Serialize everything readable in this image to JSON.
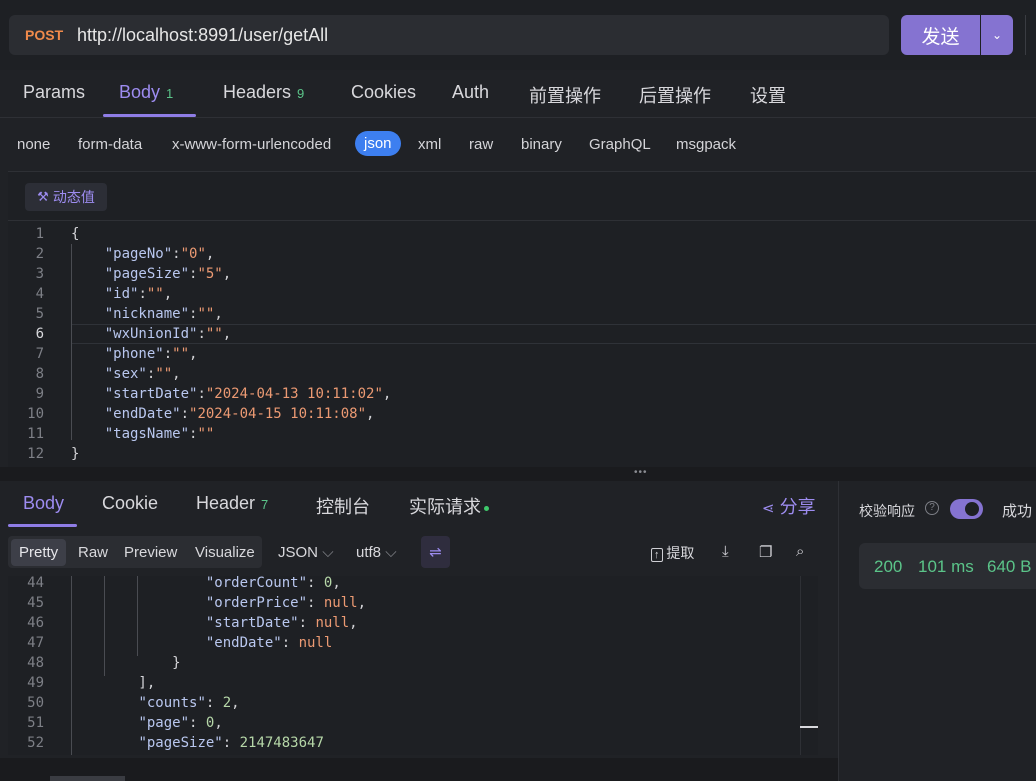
{
  "request": {
    "method": "POST",
    "url": "http://localhost:8991/user/getAll",
    "send_label": "发送",
    "send_dropdown_icon": "chevron-down-icon"
  },
  "req_tabs": [
    {
      "label": "Params",
      "badge": ""
    },
    {
      "label": "Body",
      "badge": "1"
    },
    {
      "label": "Headers",
      "badge": "9"
    },
    {
      "label": "Cookies",
      "badge": ""
    },
    {
      "label": "Auth",
      "badge": ""
    },
    {
      "label": "前置操作",
      "badge": ""
    },
    {
      "label": "后置操作",
      "badge": ""
    },
    {
      "label": "设置",
      "badge": ""
    }
  ],
  "body_types": [
    "none",
    "form-data",
    "x-www-form-urlencoded",
    "json",
    "xml",
    "raw",
    "binary",
    "GraphQL",
    "msgpack"
  ],
  "body_type_selected": "json",
  "dynamic_value_label": "动态值",
  "request_body_lines": [
    {
      "n": "1",
      "parts": [
        [
          "p",
          "{"
        ]
      ]
    },
    {
      "n": "2",
      "parts": [
        [
          "p",
          "    "
        ],
        [
          "k",
          "\"pageNo\""
        ],
        [
          "p",
          ":"
        ],
        [
          "s",
          "\"0\""
        ],
        [
          "p",
          ","
        ]
      ]
    },
    {
      "n": "3",
      "parts": [
        [
          "p",
          "    "
        ],
        [
          "k",
          "\"pageSize\""
        ],
        [
          "p",
          ":"
        ],
        [
          "s",
          "\"5\""
        ],
        [
          "p",
          ","
        ]
      ]
    },
    {
      "n": "4",
      "parts": [
        [
          "p",
          "    "
        ],
        [
          "k",
          "\"id\""
        ],
        [
          "p",
          ":"
        ],
        [
          "s",
          "\"\""
        ],
        [
          "p",
          ","
        ]
      ]
    },
    {
      "n": "5",
      "parts": [
        [
          "p",
          "    "
        ],
        [
          "k",
          "\"nickname\""
        ],
        [
          "p",
          ":"
        ],
        [
          "s",
          "\"\""
        ],
        [
          "p",
          ","
        ]
      ]
    },
    {
      "n": "6",
      "parts": [
        [
          "p",
          "    "
        ],
        [
          "k",
          "\"wxUnionId\""
        ],
        [
          "p",
          ":"
        ],
        [
          "s",
          "\"\""
        ],
        [
          "p",
          ","
        ]
      ]
    },
    {
      "n": "7",
      "parts": [
        [
          "p",
          "    "
        ],
        [
          "k",
          "\"phone\""
        ],
        [
          "p",
          ":"
        ],
        [
          "s",
          "\"\""
        ],
        [
          "p",
          ","
        ]
      ]
    },
    {
      "n": "8",
      "parts": [
        [
          "p",
          "    "
        ],
        [
          "k",
          "\"sex\""
        ],
        [
          "p",
          ":"
        ],
        [
          "s",
          "\"\""
        ],
        [
          "p",
          ","
        ]
      ]
    },
    {
      "n": "9",
      "parts": [
        [
          "p",
          "    "
        ],
        [
          "k",
          "\"startDate\""
        ],
        [
          "p",
          ":"
        ],
        [
          "s",
          "\"2024-04-13 10:11:02\""
        ],
        [
          "p",
          ","
        ]
      ]
    },
    {
      "n": "10",
      "parts": [
        [
          "p",
          "    "
        ],
        [
          "k",
          "\"endDate\""
        ],
        [
          "p",
          ":"
        ],
        [
          "s",
          "\"2024-04-15 10:11:08\""
        ],
        [
          "p",
          ","
        ]
      ]
    },
    {
      "n": "11",
      "parts": [
        [
          "p",
          "    "
        ],
        [
          "k",
          "\"tagsName\""
        ],
        [
          "p",
          ":"
        ],
        [
          "s",
          "\"\""
        ]
      ]
    },
    {
      "n": "12",
      "parts": [
        [
          "p",
          "}"
        ]
      ]
    }
  ],
  "current_line": "6",
  "resp_tabs": [
    {
      "label": "Body",
      "badge": ""
    },
    {
      "label": "Cookie",
      "badge": ""
    },
    {
      "label": "Header",
      "badge": "7"
    },
    {
      "label": "控制台",
      "badge": ""
    },
    {
      "label": "实际请求",
      "badge": ""
    }
  ],
  "share_label": "分享",
  "format_tabs": [
    "Pretty",
    "Raw",
    "Preview",
    "Visualize"
  ],
  "format_selected": "Pretty",
  "lang_select": "JSON",
  "encoding_select": "utf8",
  "extract_label": "提取",
  "response_lines": [
    {
      "n": "44",
      "parts": [
        [
          "p",
          "                "
        ],
        [
          "k",
          "\"orderCount\""
        ],
        [
          "p",
          ": "
        ],
        [
          "n",
          "0"
        ],
        [
          "p",
          ","
        ]
      ]
    },
    {
      "n": "45",
      "parts": [
        [
          "p",
          "                "
        ],
        [
          "k",
          "\"orderPrice\""
        ],
        [
          "p",
          ": "
        ],
        [
          "nl",
          "null"
        ],
        [
          "p",
          ","
        ]
      ]
    },
    {
      "n": "46",
      "parts": [
        [
          "p",
          "                "
        ],
        [
          "k",
          "\"startDate\""
        ],
        [
          "p",
          ": "
        ],
        [
          "nl",
          "null"
        ],
        [
          "p",
          ","
        ]
      ]
    },
    {
      "n": "47",
      "parts": [
        [
          "p",
          "                "
        ],
        [
          "k",
          "\"endDate\""
        ],
        [
          "p",
          ": "
        ],
        [
          "nl",
          "null"
        ]
      ]
    },
    {
      "n": "48",
      "parts": [
        [
          "p",
          "            }"
        ]
      ]
    },
    {
      "n": "49",
      "parts": [
        [
          "p",
          "        ],"
        ]
      ]
    },
    {
      "n": "50",
      "parts": [
        [
          "p",
          "        "
        ],
        [
          "k",
          "\"counts\""
        ],
        [
          "p",
          ": "
        ],
        [
          "n",
          "2"
        ],
        [
          "p",
          ","
        ]
      ]
    },
    {
      "n": "51",
      "parts": [
        [
          "p",
          "        "
        ],
        [
          "k",
          "\"page\""
        ],
        [
          "p",
          ": "
        ],
        [
          "n",
          "0"
        ],
        [
          "p",
          ","
        ]
      ]
    },
    {
      "n": "52",
      "parts": [
        [
          "p",
          "        "
        ],
        [
          "k",
          "\"pageSize\""
        ],
        [
          "p",
          ": "
        ],
        [
          "n",
          "2147483647"
        ]
      ]
    }
  ],
  "verify": {
    "label": "校验响应",
    "toggle_on": true,
    "result": "成功"
  },
  "status": {
    "code": "200",
    "time": "101 ms",
    "size": "640 B"
  },
  "colors": {
    "accent": "#8573d1",
    "success": "#5bc489",
    "method": "#f08a4b",
    "json_selected": "#3d7ff0"
  }
}
